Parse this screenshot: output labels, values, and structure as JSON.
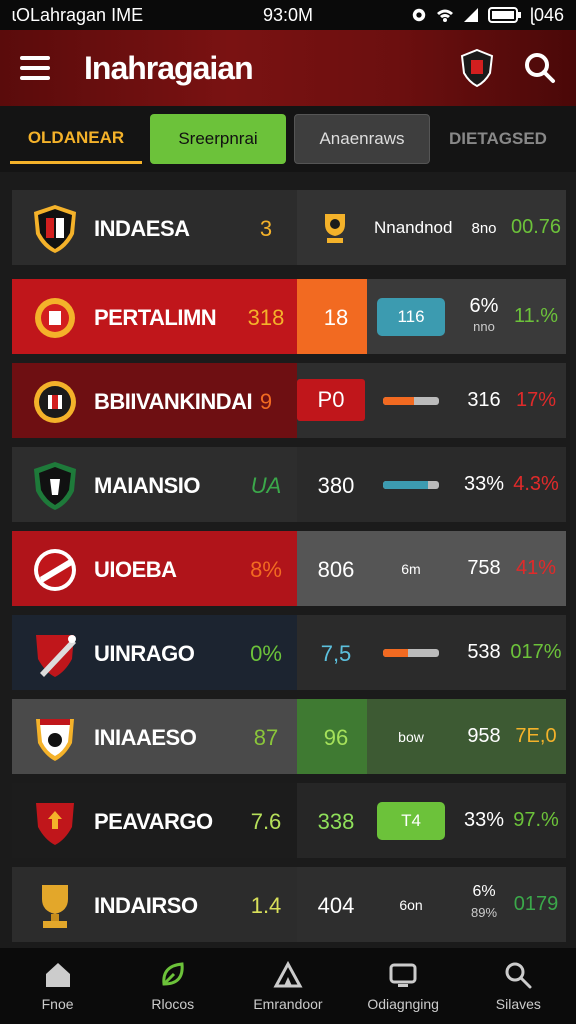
{
  "status_bar": {
    "left": "ɩOLahragan IME",
    "time": "93:0M",
    "right": "ɭ046"
  },
  "header": {
    "title": "Inahragaian"
  },
  "tabs": [
    {
      "label": "OLDANEAR"
    },
    {
      "label": "Sreerpnrai"
    },
    {
      "label": "Anaenraws"
    },
    {
      "label": "DIETAGSED"
    }
  ],
  "rows": [
    {
      "team": "INDAESA",
      "score": "3",
      "value": "",
      "slot_text": "Nnandnod",
      "pct1": "8no",
      "pct2": "00.76"
    },
    {
      "team": "PERTALIMN",
      "score": "318",
      "value": "18",
      "slot_text": "116",
      "pct1": "6%",
      "pct1_sub": "nno",
      "pct2": "11.%"
    },
    {
      "team": "BBIIVANKINDAI",
      "score": "9",
      "value": "P0",
      "slot_text": "",
      "pct1": "316",
      "pct2": "17%"
    },
    {
      "team": "MAIANSIO",
      "score": "UA",
      "value": "380",
      "slot_text": "",
      "pct1": "33%",
      "pct2": "4.3%"
    },
    {
      "team": "UIOEBA",
      "score": "8%",
      "value": "806",
      "slot_text": "6m",
      "pct1": "758",
      "pct2": "41%"
    },
    {
      "team": "UINRAGO",
      "score": "0%",
      "value": "7,5",
      "slot_text": "",
      "pct1": "538",
      "pct2": "017%"
    },
    {
      "team": "INIAAESO",
      "score": "87",
      "value": "96",
      "slot_text": "bow",
      "pct1": "958",
      "pct2": "7E,0"
    },
    {
      "team": "PEAVARGO",
      "score": "7.6",
      "value": "338",
      "slot_text": "T4",
      "pct1": "33%",
      "pct2": "97.%"
    },
    {
      "team": "INDAIRSO",
      "score": "1.4",
      "value": "404",
      "slot_text": "6on",
      "pct1": "6%",
      "pct1_sub": "89%",
      "pct2": "0179"
    }
  ],
  "progress_bars": {
    "row3": 0.55,
    "row4": 0.8,
    "row6": 0.45
  },
  "bottom_nav": [
    {
      "label": "Fnoe",
      "icon": "home-icon"
    },
    {
      "label": "Rlocos",
      "icon": "leaf-icon"
    },
    {
      "label": "Emrandoor",
      "icon": "tent-icon"
    },
    {
      "label": "Odiagnging",
      "icon": "tv-icon"
    },
    {
      "label": "Silaves",
      "icon": "search-icon"
    }
  ],
  "colors": {
    "accent_green": "#6cc23a",
    "accent_red": "#b0141a",
    "accent_orange": "#f26a21",
    "accent_teal": "#3c9bb0",
    "gold": "#f4b22a"
  }
}
